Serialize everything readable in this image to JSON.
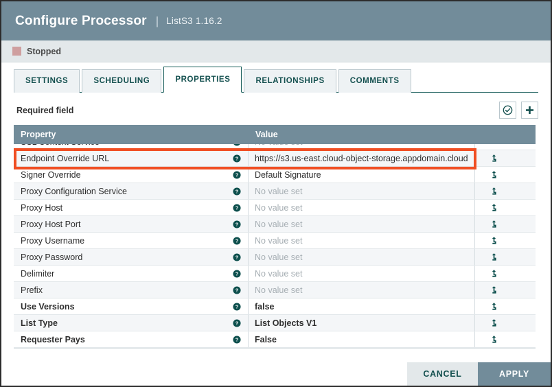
{
  "header": {
    "title": "Configure Processor",
    "separator": "|",
    "subtitle": "ListS3 1.16.2"
  },
  "status": {
    "label": "Stopped",
    "color": "#cf9f9f"
  },
  "tabs": [
    {
      "label": "SETTINGS",
      "active": false
    },
    {
      "label": "SCHEDULING",
      "active": false
    },
    {
      "label": "PROPERTIES",
      "active": true
    },
    {
      "label": "RELATIONSHIPS",
      "active": false
    },
    {
      "label": "COMMENTS",
      "active": false
    }
  ],
  "toolbar": {
    "required_field_label": "Required field",
    "verify_icon": "check-circle-icon",
    "add_icon": "plus-icon"
  },
  "table": {
    "columns": [
      "Property",
      "Value"
    ],
    "unset_placeholder": "No value set",
    "rows": [
      {
        "property": "SSL Context Service",
        "value": "No value set",
        "unset": true,
        "bold": false,
        "clipped": true,
        "action": false
      },
      {
        "property": "Endpoint Override URL",
        "value": "https://s3.us-east.cloud-object-storage.appdomain.cloud",
        "unset": false,
        "bold": false,
        "highlighted": true,
        "action": true
      },
      {
        "property": "Signer Override",
        "value": "Default Signature",
        "unset": false,
        "bold": false,
        "action": true
      },
      {
        "property": "Proxy Configuration Service",
        "value": "No value set",
        "unset": true,
        "bold": false,
        "action": true
      },
      {
        "property": "Proxy Host",
        "value": "No value set",
        "unset": true,
        "bold": false,
        "action": true
      },
      {
        "property": "Proxy Host Port",
        "value": "No value set",
        "unset": true,
        "bold": false,
        "action": true
      },
      {
        "property": "Proxy Username",
        "value": "No value set",
        "unset": true,
        "bold": false,
        "action": true
      },
      {
        "property": "Proxy Password",
        "value": "No value set",
        "unset": true,
        "bold": false,
        "action": true
      },
      {
        "property": "Delimiter",
        "value": "No value set",
        "unset": true,
        "bold": false,
        "action": true
      },
      {
        "property": "Prefix",
        "value": "No value set",
        "unset": true,
        "bold": false,
        "action": true
      },
      {
        "property": "Use Versions",
        "value": "false",
        "unset": false,
        "bold": true,
        "action": true
      },
      {
        "property": "List Type",
        "value": "List Objects V1",
        "unset": false,
        "bold": true,
        "action": true
      },
      {
        "property": "Requester Pays",
        "value": "False",
        "unset": false,
        "bold": true,
        "action": true
      }
    ]
  },
  "footer": {
    "cancel_label": "CANCEL",
    "apply_label": "APPLY"
  },
  "colors": {
    "header_bg": "#728c9a",
    "accent_teal": "#14504f",
    "highlight_red": "#f04e23",
    "status_red": "#cf9f9f"
  }
}
